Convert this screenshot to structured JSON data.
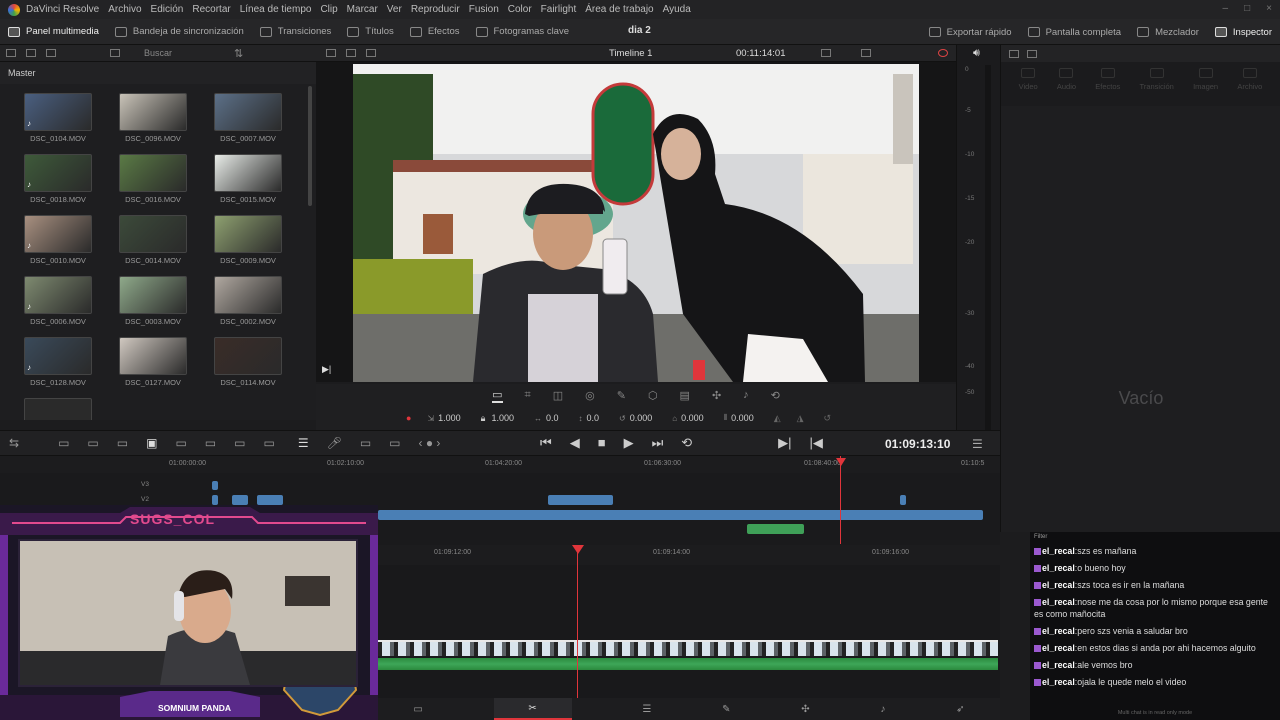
{
  "menubar": {
    "app": "DaVinci Resolve",
    "items": [
      "Archivo",
      "Edición",
      "Recortar",
      "Línea de tiempo",
      "Clip",
      "Marcar",
      "Ver",
      "Reproducir",
      "Fusion",
      "Color",
      "Fairlight",
      "Área de trabajo",
      "Ayuda"
    ]
  },
  "toolbar": {
    "left": [
      "Panel multimedia",
      "Bandeja de sincronización",
      "Transiciones",
      "Títulos",
      "Efectos",
      "Fotogramas clave"
    ],
    "project": "dia 2",
    "right": [
      "Exportar rápido",
      "Pantalla completa",
      "Mezclador",
      "Inspector"
    ]
  },
  "media_pool": {
    "search_placeholder": "Buscar",
    "bin": "Master",
    "clips": [
      "DSC_0104.MOV",
      "DSC_0096.MOV",
      "DSC_0007.MOV",
      "DSC_0018.MOV",
      "DSC_0016.MOV",
      "DSC_0015.MOV",
      "DSC_0010.MOV",
      "DSC_0014.MOV",
      "DSC_0009.MOV",
      "DSC_0006.MOV",
      "DSC_0003.MOV",
      "DSC_0002.MOV",
      "DSC_0128.MOV",
      "DSC_0127.MOV",
      "DSC_0114.MOV"
    ],
    "thumb_colors": [
      "#4a5f80",
      "#c9c3b8",
      "#5c7088",
      "#3e5a3a",
      "#5a7a45",
      "#e8ece8",
      "#a89080",
      "#3c4a3a",
      "#8ea070",
      "#7e8a70",
      "#8fa98a",
      "#b0a8a0",
      "#3a4a5a",
      "#d0c8c0",
      "#3a2c28"
    ]
  },
  "viewer": {
    "timeline_name": "Timeline 1",
    "timecode": "00:11:14:01"
  },
  "transform": {
    "zoom_x": "1.000",
    "zoom_y": "1.000",
    "pos_x": "0.0",
    "pos_y": "0.0",
    "rotation": "0.000",
    "pitch": "0.000",
    "yaw": "0.000"
  },
  "audio_meter": {
    "labels": [
      "0",
      "-5",
      "-10",
      "-15",
      "-20",
      "-30",
      "-40",
      "-50"
    ]
  },
  "inspector": {
    "tabs": [
      "Video",
      "Audio",
      "Efectos",
      "Transición",
      "Imagen",
      "Archivo"
    ],
    "empty": "Vacío"
  },
  "timeline": {
    "playhead_timecode": "01:09:13:10",
    "upper_ruler": [
      "01:00:00:00",
      "01:02:10:00",
      "01:04:20:00",
      "01:06:30:00",
      "01:08:40:00",
      "01:10:5"
    ],
    "track_labels": [
      "V3",
      "V2"
    ],
    "lower_ruler": [
      "01:09:12:00",
      "01:09:14:00",
      "01:09:16:00"
    ]
  },
  "webcam": {
    "title": "SUGS_COL",
    "footer": "SOMNIUM PANDA"
  },
  "chat": {
    "header": "Filter",
    "messages": [
      {
        "user": "el_recal",
        "text": "szs es mañana"
      },
      {
        "user": "el_recal",
        "text": "o bueno hoy"
      },
      {
        "user": "el_recal",
        "text": "szs toca es ir en la mañana"
      },
      {
        "user": "el_recal",
        "text": "nose me da cosa por lo mismo porque esa gente es como mañocita"
      },
      {
        "user": "el_recal",
        "text": "pero szs venia a saludar bro"
      },
      {
        "user": "el_recal",
        "text": "en estos dias si anda por ahi hacemos alguito"
      },
      {
        "user": "el_recal",
        "text": "ale vemos bro"
      },
      {
        "user": "el_recal",
        "text": "ojala le quede melo el video"
      }
    ],
    "footer": "Multi chat is in read only mode"
  }
}
